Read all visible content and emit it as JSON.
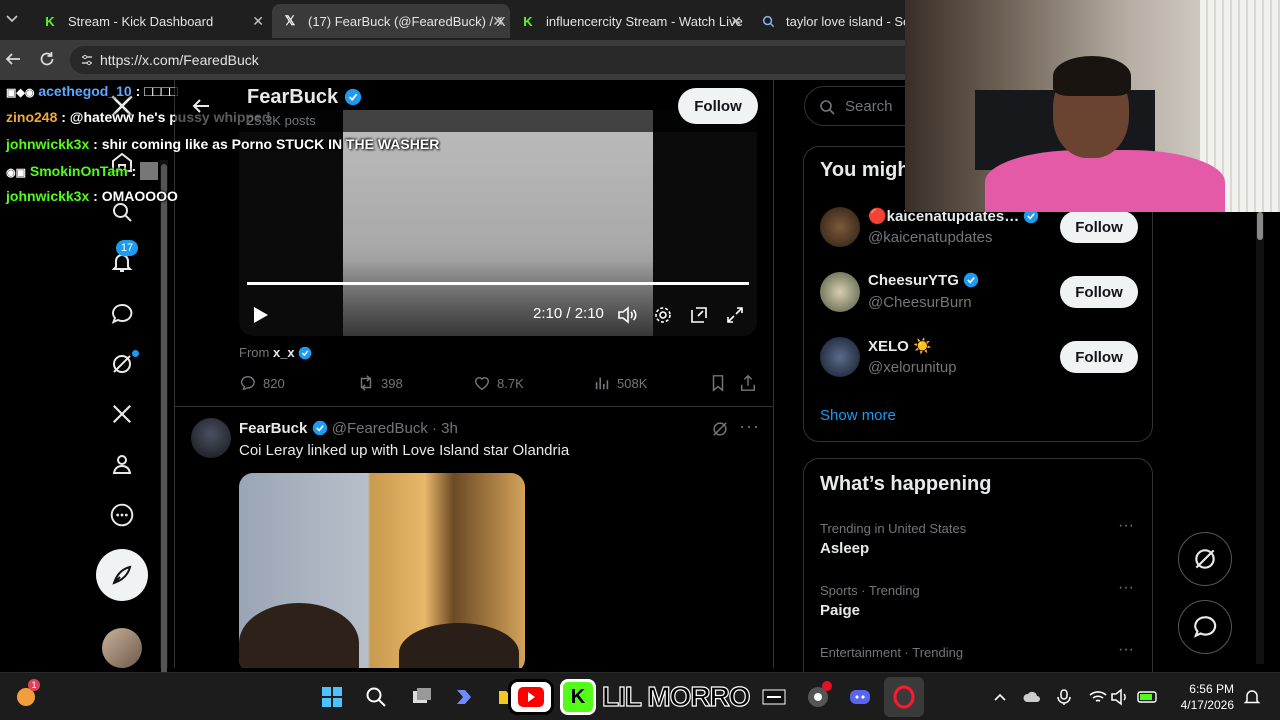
{
  "browser": {
    "tabs": [
      {
        "title": "Stream - Kick Dashboard",
        "favicon": "kick-icon",
        "active": false
      },
      {
        "title": "(17) FearBuck (@FearedBuck) / X",
        "favicon": "x-icon",
        "active": true
      },
      {
        "title": "influencercity Stream - Watch Live",
        "favicon": "kick-icon",
        "active": false
      },
      {
        "title": "taylor love island - Sear",
        "favicon": "search-icon",
        "active": false
      }
    ],
    "url": "https://x.com/FearedBuck"
  },
  "chat_overlay": [
    {
      "user": "acethegod_10",
      "message": " : □□□□",
      "color": "#5fa8ff"
    },
    {
      "user": "zino248",
      "message": " : @hateww he's pussy whipped",
      "color": "#f1a83b"
    },
    {
      "user": "johnwickk3x",
      "message": " : shir coming like as Porno STUCK IN THE WASHER",
      "color": "#53fc18"
    },
    {
      "user": "SmokinOnTam",
      "message": " : ",
      "color": "#53fc18"
    },
    {
      "user": "johnwickk3x",
      "message": " : OMAOOOO",
      "color": "#53fc18"
    }
  ],
  "sidebar": {
    "notifications_badge": "17"
  },
  "profile_header": {
    "name": "FearBuck",
    "posts": "25.3K posts",
    "follow_label": "Follow"
  },
  "video": {
    "time": "2:10 / 2:10",
    "from_label": "From",
    "from_user": "x_x",
    "progress": 1.0
  },
  "post1_actions": {
    "replies": "820",
    "reposts": "398",
    "likes": "8.7K",
    "views": "508K"
  },
  "post2": {
    "name": "FearBuck",
    "handle": "@FearedBuck · 3h",
    "text": "Coi Leray linked up with Love Island star Olandria"
  },
  "search": {
    "placeholder": "Search"
  },
  "who_to_follow": {
    "title": "You migh",
    "users": [
      {
        "name": "🔴kaicenatupdates…",
        "handle": "@kaicenatupdates",
        "follow": "Follow"
      },
      {
        "name": "CheesurYTG",
        "handle": "@CheesurBurn",
        "follow": "Follow"
      },
      {
        "name": "XELO ☀️",
        "handle": "@xelorunitup",
        "follow": "Follow"
      }
    ],
    "show_more": "Show more"
  },
  "whats_happening": {
    "title": "What’s happening",
    "trends": [
      {
        "context": "Trending in United States",
        "topic": "Asleep"
      },
      {
        "context": "Sports · Trending",
        "topic": "Paige"
      },
      {
        "context": "Entertainment · Trending",
        "topic": ""
      }
    ]
  },
  "taskbar": {
    "stream_label": "LIL MORRO",
    "time": "6:56 PM",
    "date": "4/17/2026"
  },
  "colors": {
    "x_blue": "#1d9bf0",
    "kick_green": "#53fc18",
    "tab_active": "#3a3a3a"
  }
}
